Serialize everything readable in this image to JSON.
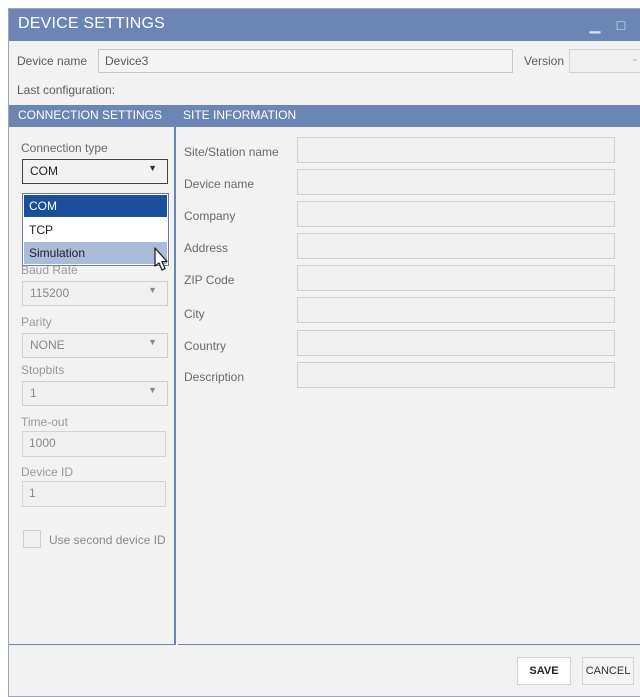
{
  "window": {
    "title": "DEVICE SETTINGS",
    "minimize_glyph": "▁",
    "maximize_glyph": "□",
    "close_glyph": "×"
  },
  "header": {
    "device_name_label": "Device name",
    "device_name_value": "Device3",
    "version_label": "Version",
    "version_value": "",
    "last_configuration_label": "Last configuration:"
  },
  "sections": {
    "connection": "CONNECTION SETTINGS",
    "site": "SITE INFORMATION"
  },
  "connection": {
    "type_label": "Connection type",
    "type_value": "COM",
    "type_options": [
      "COM",
      "TCP",
      "Simulation"
    ],
    "selected_option": "COM",
    "hovered_option": "Simulation",
    "baud_rate_label": "Baud Rate",
    "baud_rate_value": "115200",
    "parity_label": "Parity",
    "parity_value": "NONE",
    "stopbits_label": "Stopbits",
    "stopbits_value": "1",
    "timeout_label": "Time-out",
    "timeout_value": "1000",
    "device_id_label": "Device ID",
    "device_id_value": "1",
    "second_device_label": "Use second device ID",
    "second_device_checked": false
  },
  "site": {
    "fields": [
      {
        "label": "Site/Station name",
        "value": ""
      },
      {
        "label": "Device name",
        "value": ""
      },
      {
        "label": "Company",
        "value": ""
      },
      {
        "label": "Address",
        "value": ""
      },
      {
        "label": "ZIP Code",
        "value": ""
      },
      {
        "label": "City",
        "value": ""
      },
      {
        "label": "Country",
        "value": ""
      },
      {
        "label": "Description",
        "value": ""
      }
    ]
  },
  "footer": {
    "save_label": "SAVE",
    "cancel_label": "CANCEL"
  },
  "icons": {
    "dropdown_arrow": "chevron-down-icon",
    "cursor": "mouse-pointer-icon"
  },
  "colors": {
    "accent": "#6b86b4",
    "selected_item": "#1c4f9a",
    "hover_item": "#a9bcd9"
  }
}
